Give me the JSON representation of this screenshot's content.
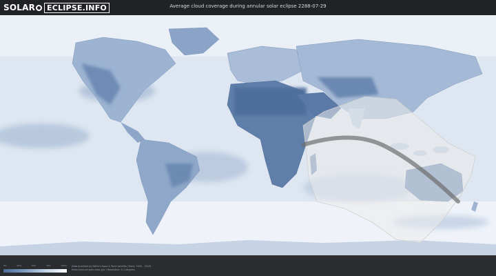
{
  "header": {
    "logo_left": "SOLAR",
    "logo_right": "ECLIPSE.INFO",
    "title": "Average cloud coverage during annular solar eclipse 2288-07-29"
  },
  "legend": {
    "ticks": [
      "0%",
      "25%",
      "50%",
      "75%",
      "100%"
    ],
    "colors": {
      "clear": "#4a6a98",
      "cloudy": "#ffffff"
    }
  },
  "footer": {
    "credit_line1": "Data provided by NASA's Aqua & Terra satellite (Years: 2000 - 2019)",
    "credit_line2": "https://neo.sci.gsfc.nasa.gov | Resolution: 0.1 degrees"
  },
  "map": {
    "colors": {
      "ocean": "#d9e4f0",
      "land_dark": "#5b7aa8",
      "eclipse_zone": "#ebebeb",
      "central_path": "#6e6e6e"
    }
  }
}
